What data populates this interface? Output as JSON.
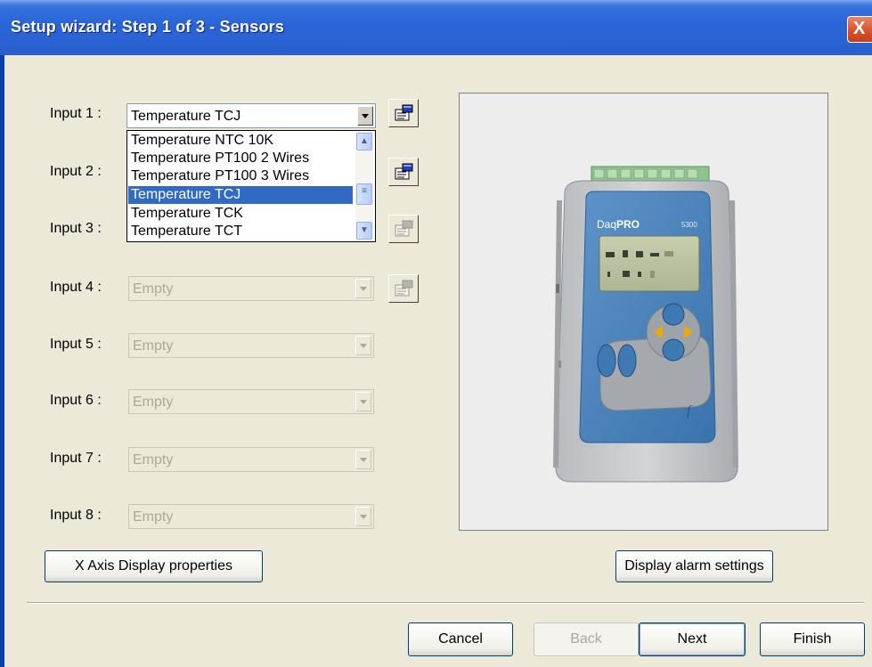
{
  "window": {
    "title": "Setup wizard: Step 1 of 3 - Sensors",
    "close_glyph": "X"
  },
  "inputs": [
    {
      "label": "Input 1 :",
      "value": "Temperature TCJ",
      "enabled": true
    },
    {
      "label": "Input 2 :",
      "value": "",
      "enabled": true
    },
    {
      "label": "Input 3 :",
      "value": "",
      "enabled": true
    },
    {
      "label": "Input 4 :",
      "value": "Empty",
      "enabled": false
    },
    {
      "label": "Input 5 :",
      "value": "Empty",
      "enabled": false
    },
    {
      "label": "Input 6 :",
      "value": "Empty",
      "enabled": false
    },
    {
      "label": "Input 7 :",
      "value": "Empty",
      "enabled": false
    },
    {
      "label": "Input 8 :",
      "value": "Empty",
      "enabled": false
    }
  ],
  "dropdown": {
    "options": [
      "Temperature NTC 10K",
      "Temperature PT100 2 Wires",
      "Temperature PT100 3 Wires",
      "Temperature TCJ",
      "Temperature TCK",
      "Temperature TCT"
    ],
    "selected": "Temperature TCJ"
  },
  "device": {
    "brand_prefix": "Daq",
    "brand_suffix": "PRO",
    "model": "5300",
    "logo_glyph": "f"
  },
  "buttons": {
    "x_axis": "X Axis Display properties",
    "alarm": "Display alarm settings",
    "cancel": "Cancel",
    "back": "Back",
    "next": "Next",
    "finish": "Finish"
  },
  "icons": {
    "sensor_properties": "properties-icon",
    "close": "close-icon"
  },
  "colors": {
    "title_bar": "#2a63d6",
    "selection": "#316ac5",
    "device_blue": "#4d86bd",
    "close_button": "#d6532d"
  }
}
